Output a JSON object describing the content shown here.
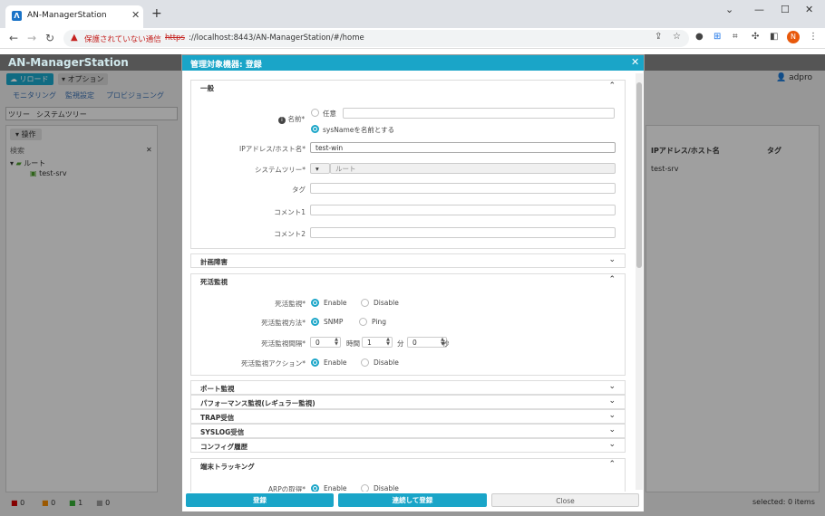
{
  "browser": {
    "tab_title": "AN-ManagerStation",
    "insecure_label": "保護されていない通信",
    "url_scheme": "https",
    "url_rest": "://localhost:8443/AN-ManagerStation/#/home",
    "profile_initial": "N"
  },
  "app": {
    "title": "AN-ManagerStation",
    "reload_label": "リロード",
    "options_label": "オプション",
    "user": "adpro",
    "menu": [
      "モニタリング",
      "監視設定",
      "プロビジョニング"
    ],
    "tree_label": "ツリー",
    "tree_value": "システムツリー",
    "ops_label": "操作",
    "search_label": "検索",
    "tree_root": "ルート",
    "tree_child": "test-srv",
    "grid_col_ip": "IPアドレス/ホスト名",
    "grid_col_tag": "タグ",
    "grid_row_ip": "test-srv",
    "status_counts": [
      "0",
      "0",
      "1",
      "0"
    ],
    "selected_text": "selected: 0 items"
  },
  "modal": {
    "title": "管理対象機器: 登録",
    "general": {
      "header": "一般",
      "name_label": "名前*",
      "name_opt_any": "任意",
      "name_opt_sysname": "sysNameを名前とする",
      "ip_label": "IPアドレス/ホスト名*",
      "ip_value": "test-win",
      "systree_label": "システムツリー*",
      "systree_value": "ルート",
      "tag_label": "タグ",
      "comment1_label": "コメント1",
      "comment2_label": "コメント2"
    },
    "planned_outage": {
      "header": "計画障害"
    },
    "alive": {
      "header": "死活監視",
      "alive_label": "死活監視*",
      "enable": "Enable",
      "disable": "Disable",
      "method_label": "死活監視方法*",
      "snmp": "SNMP",
      "ping": "Ping",
      "interval_label": "死活監視間隔*",
      "hours": "0",
      "hours_unit": "時間",
      "minutes": "1",
      "minutes_unit": "分",
      "seconds": "0",
      "seconds_unit": "秒",
      "action_label": "死活監視アクション*"
    },
    "collapsed_sections": [
      "ポート監視",
      "パフォーマンス監視(レギュラー監視)",
      "TRAP受信",
      "SYSLOG受信",
      "コンフィグ履歴"
    ],
    "terminal": {
      "header": "端末トラッキング",
      "arp_label": "ARPの取得*",
      "enable": "Enable",
      "disable": "Disable"
    },
    "footer": {
      "register": "登録",
      "register_continue": "連続して登録",
      "close": "Close"
    }
  }
}
